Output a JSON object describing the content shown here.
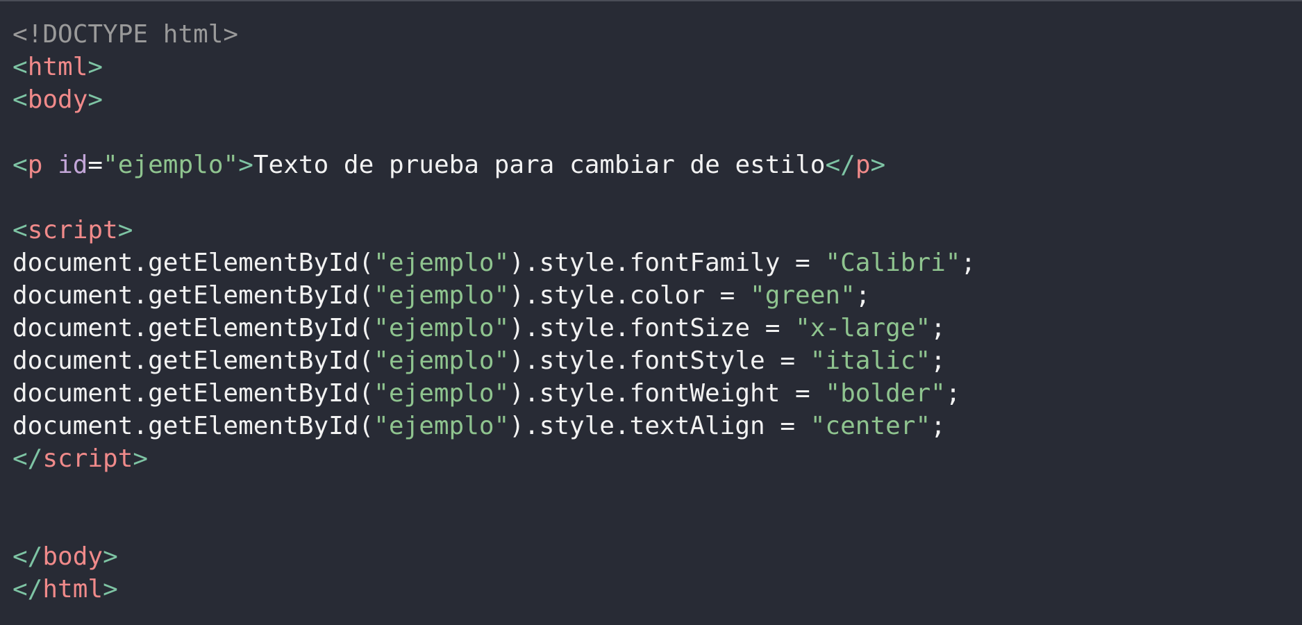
{
  "colors": {
    "background": "#282b35",
    "plain": "#f2f2f2",
    "doctype": "#9a9a9a",
    "bracket": "#7ec4a4",
    "tag": "#f08a8a",
    "attr": "#c3a6d8",
    "string": "#8fc48f"
  },
  "editor": {
    "lines": [
      [
        {
          "t": "<!DOCTYPE html>",
          "c": "doctype"
        }
      ],
      [
        {
          "t": "<",
          "c": "bracket"
        },
        {
          "t": "html",
          "c": "tag"
        },
        {
          "t": ">",
          "c": "bracket"
        }
      ],
      [
        {
          "t": "<",
          "c": "bracket"
        },
        {
          "t": "body",
          "c": "tag"
        },
        {
          "t": ">",
          "c": "bracket"
        }
      ],
      [],
      [
        {
          "t": "<",
          "c": "bracket"
        },
        {
          "t": "p",
          "c": "tag"
        },
        {
          "t": " ",
          "c": "plain"
        },
        {
          "t": "id",
          "c": "attr"
        },
        {
          "t": "=",
          "c": "plain"
        },
        {
          "t": "\"ejemplo\"",
          "c": "string"
        },
        {
          "t": ">",
          "c": "bracket"
        },
        {
          "t": "Texto de prueba para cambiar de estilo",
          "c": "plain"
        },
        {
          "t": "</",
          "c": "bracket"
        },
        {
          "t": "p",
          "c": "tag"
        },
        {
          "t": ">",
          "c": "bracket"
        }
      ],
      [],
      [
        {
          "t": "<",
          "c": "bracket"
        },
        {
          "t": "script",
          "c": "tag"
        },
        {
          "t": ">",
          "c": "bracket"
        }
      ],
      [
        {
          "t": "document.getElementById(",
          "c": "plain"
        },
        {
          "t": "\"ejemplo\"",
          "c": "string"
        },
        {
          "t": ").style.fontFamily = ",
          "c": "plain"
        },
        {
          "t": "\"Calibri\"",
          "c": "string"
        },
        {
          "t": ";",
          "c": "plain"
        }
      ],
      [
        {
          "t": "document.getElementById(",
          "c": "plain"
        },
        {
          "t": "\"ejemplo\"",
          "c": "string"
        },
        {
          "t": ").style.color = ",
          "c": "plain"
        },
        {
          "t": "\"green\"",
          "c": "string"
        },
        {
          "t": ";",
          "c": "plain"
        }
      ],
      [
        {
          "t": "document.getElementById(",
          "c": "plain"
        },
        {
          "t": "\"ejemplo\"",
          "c": "string"
        },
        {
          "t": ").style.fontSize = ",
          "c": "plain"
        },
        {
          "t": "\"x-large\"",
          "c": "string"
        },
        {
          "t": ";",
          "c": "plain"
        }
      ],
      [
        {
          "t": "document.getElementById(",
          "c": "plain"
        },
        {
          "t": "\"ejemplo\"",
          "c": "string"
        },
        {
          "t": ").style.fontStyle = ",
          "c": "plain"
        },
        {
          "t": "\"italic\"",
          "c": "string"
        },
        {
          "t": ";",
          "c": "plain"
        }
      ],
      [
        {
          "t": "document.getElementById(",
          "c": "plain"
        },
        {
          "t": "\"ejemplo\"",
          "c": "string"
        },
        {
          "t": ").style.fontWeight = ",
          "c": "plain"
        },
        {
          "t": "\"bolder\"",
          "c": "string"
        },
        {
          "t": ";",
          "c": "plain"
        }
      ],
      [
        {
          "t": "document.getElementById(",
          "c": "plain"
        },
        {
          "t": "\"ejemplo\"",
          "c": "string"
        },
        {
          "t": ").style.textAlign = ",
          "c": "plain"
        },
        {
          "t": "\"center\"",
          "c": "string"
        },
        {
          "t": ";",
          "c": "plain"
        }
      ],
      [
        {
          "t": "</",
          "c": "bracket"
        },
        {
          "t": "script",
          "c": "tag"
        },
        {
          "t": ">",
          "c": "bracket"
        }
      ],
      [],
      [],
      [
        {
          "t": "</",
          "c": "bracket"
        },
        {
          "t": "body",
          "c": "tag"
        },
        {
          "t": ">",
          "c": "bracket"
        }
      ],
      [
        {
          "t": "</",
          "c": "bracket"
        },
        {
          "t": "html",
          "c": "tag"
        },
        {
          "t": ">",
          "c": "bracket"
        }
      ]
    ]
  }
}
